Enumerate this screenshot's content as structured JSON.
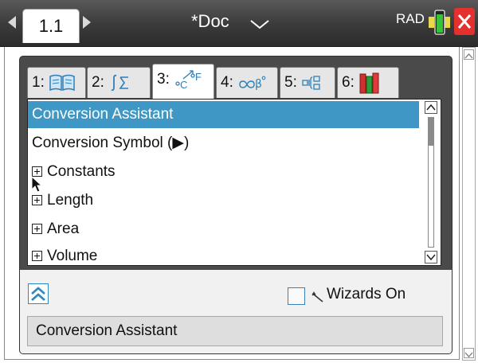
{
  "topbar": {
    "page_tab": "1.1",
    "doc_title": "*Doc",
    "angle_mode": "RAD"
  },
  "catalog": {
    "tabs": [
      {
        "label": "1:",
        "icon": "book-icon"
      },
      {
        "label": "2:",
        "icon": "integral-sigma-icon"
      },
      {
        "label": "3:",
        "icon": "degree-conversion-icon"
      },
      {
        "label": "4:",
        "icon": "infinity-beta-icon"
      },
      {
        "label": "5:",
        "icon": "template-icon"
      },
      {
        "label": "6:",
        "icon": "library-books-icon"
      }
    ],
    "active_tab": 3,
    "items": [
      {
        "label": "Conversion Assistant",
        "selected": true,
        "expandable": false
      },
      {
        "label": "Conversion Symbol (▶)",
        "selected": false,
        "expandable": false
      },
      {
        "label": "Constants",
        "selected": false,
        "expandable": true
      },
      {
        "label": "Length",
        "selected": false,
        "expandable": true
      },
      {
        "label": "Area",
        "selected": false,
        "expandable": true
      },
      {
        "label": "Volume",
        "selected": false,
        "expandable": true
      }
    ],
    "wizards_label": "Wizards On",
    "wizards_checked": false,
    "description": "Conversion Assistant"
  },
  "colors": {
    "selection": "#3e97c5",
    "close_button": "#e53030",
    "topbar": "#3a3a3a"
  }
}
